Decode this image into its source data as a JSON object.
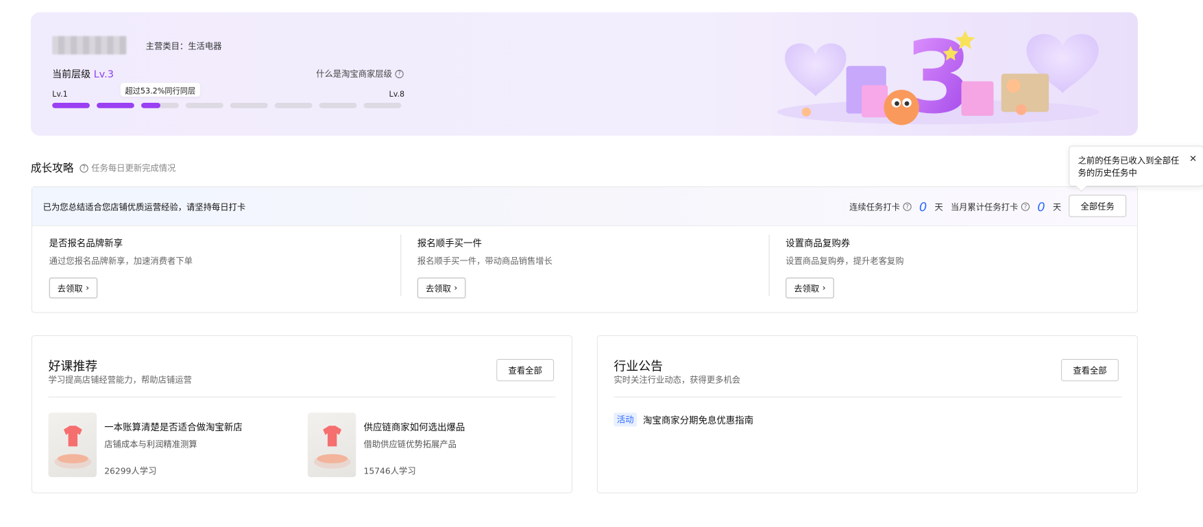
{
  "banner": {
    "category": "主营类目：生活电器",
    "level_label": "当前层级",
    "level_value": "Lv.3",
    "what_level": "什么是淘宝商家层级",
    "lv_min": "Lv.1",
    "lv_max": "Lv.8",
    "tooltip": "超过53.2%同行同层",
    "progress": [
      1,
      1,
      0.5,
      0,
      0,
      0,
      0,
      0
    ],
    "accent": "#9b3ff3",
    "art_number": "3"
  },
  "growth": {
    "title": "成长攻略",
    "subtitle": "任务每日更新完成情况",
    "hint": "已为您总结适合您店铺优质运营经验，请坚持每日打卡",
    "streak_label": "连续任务打卡",
    "streak_value": "0",
    "month_label": "当月累计任务打卡",
    "month_value": "0",
    "unit": "天",
    "all_tasks": "全部任务",
    "tasks": [
      {
        "title": "是否报名品牌新享",
        "desc": "通过您报名品牌新享，加速消费者下单",
        "btn": "去领取"
      },
      {
        "title": "报名顺手买一件",
        "desc": "报名顺手买一件，带动商品销售增长",
        "btn": "去领取"
      },
      {
        "title": "设置商品复购券",
        "desc": "设置商品复购券，提升老客复购",
        "btn": "去领取"
      }
    ]
  },
  "popover": {
    "text": "之前的任务已收入到全部任务的历史任务中"
  },
  "courses": {
    "title": "好课推荐",
    "subtitle": "学习提高店铺经营能力，帮助店铺运营",
    "more": "查看全部",
    "items": [
      {
        "name": "一本账算清楚是否适合做淘宝新店",
        "desc": "店铺成本与利润精准测算",
        "count": "26299人学习"
      },
      {
        "name": "供应链商家如何选出爆品",
        "desc": "借助供应链优势拓展产品",
        "count": "15746人学习"
      }
    ]
  },
  "news": {
    "title": "行业公告",
    "subtitle": "实时关注行业动态，获得更多机会",
    "more": "查看全部",
    "items": [
      {
        "tag": "活动",
        "text": "淘宝商家分期免息优惠指南"
      }
    ]
  }
}
